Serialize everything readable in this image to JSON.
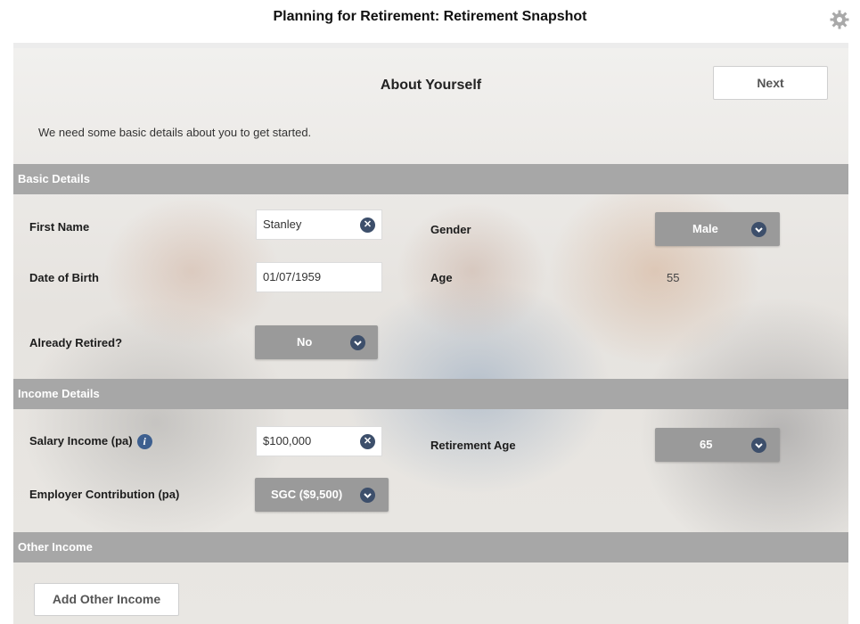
{
  "app": {
    "title": "Planning for Retirement: Retirement Snapshot"
  },
  "panel": {
    "title": "About Yourself",
    "next_label": "Next",
    "intro": "We need some basic details about you to get started."
  },
  "sections": {
    "basic": "Basic Details",
    "income": "Income Details",
    "other": "Other Income"
  },
  "basic": {
    "first_name_label": "First Name",
    "first_name_value": "Stanley",
    "gender_label": "Gender",
    "gender_value": "Male",
    "dob_label": "Date of Birth",
    "dob_value": "01/07/1959",
    "age_label": "Age",
    "age_value": "55",
    "retired_label": "Already Retired?",
    "retired_value": "No"
  },
  "income": {
    "salary_label": "Salary Income (pa)",
    "salary_value": "$100,000",
    "retirement_age_label": "Retirement Age",
    "retirement_age_value": "65",
    "employer_label": "Employer Contribution (pa)",
    "employer_value": "SGC ($9,500)"
  },
  "other": {
    "add_label": "Add Other Income"
  },
  "icons": {
    "settings": "gear-icon",
    "clear": "clear-icon",
    "chevron": "chevron-down-icon",
    "info": "info-icon"
  },
  "colors": {
    "section_bar": "#a7a7a7",
    "select_bg": "#9a9a9a",
    "icon_navy": "#3d4f6b"
  }
}
